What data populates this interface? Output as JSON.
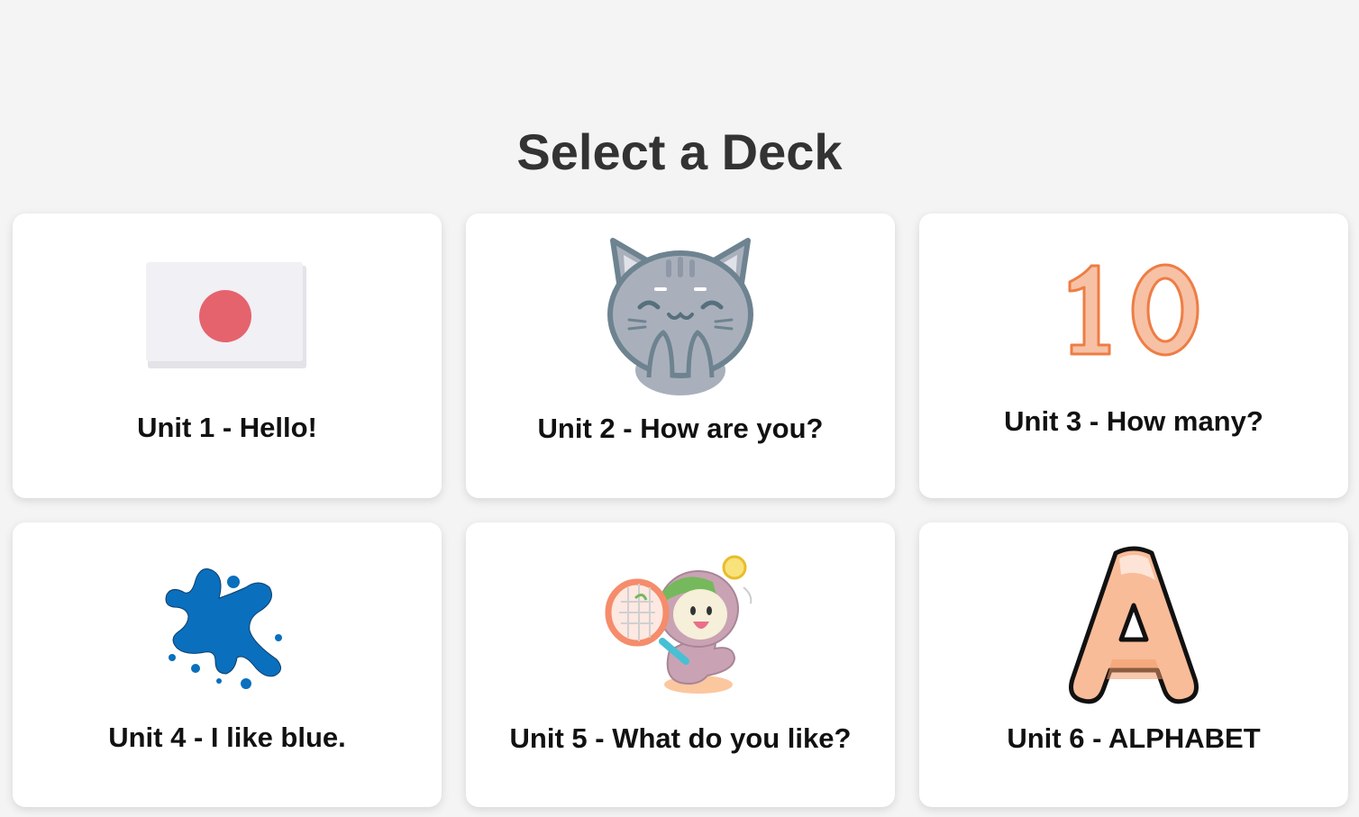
{
  "page": {
    "title": "Select a Deck"
  },
  "decks": [
    {
      "label": "Unit 1 - Hello!",
      "icon": "japan-flag-icon"
    },
    {
      "label": "Unit 2 - How are you?",
      "icon": "happy-cat-icon"
    },
    {
      "label": "Unit 3 - How many?",
      "icon": "number-ten-icon"
    },
    {
      "label": "Unit 4 - I like blue.",
      "icon": "blue-paint-splash-icon"
    },
    {
      "label": "Unit 5 - What do you like?",
      "icon": "tennis-player-icon"
    },
    {
      "label": "Unit 6 - ALPHABET",
      "icon": "letter-a-icon"
    }
  ],
  "colors": {
    "background": "#f4f4f4",
    "card": "#ffffff",
    "title_text": "#333333",
    "label_text": "#111111",
    "flag_red": "#e5636d",
    "number_orange": "#f3b393",
    "splash_blue": "#0a6fbd"
  }
}
